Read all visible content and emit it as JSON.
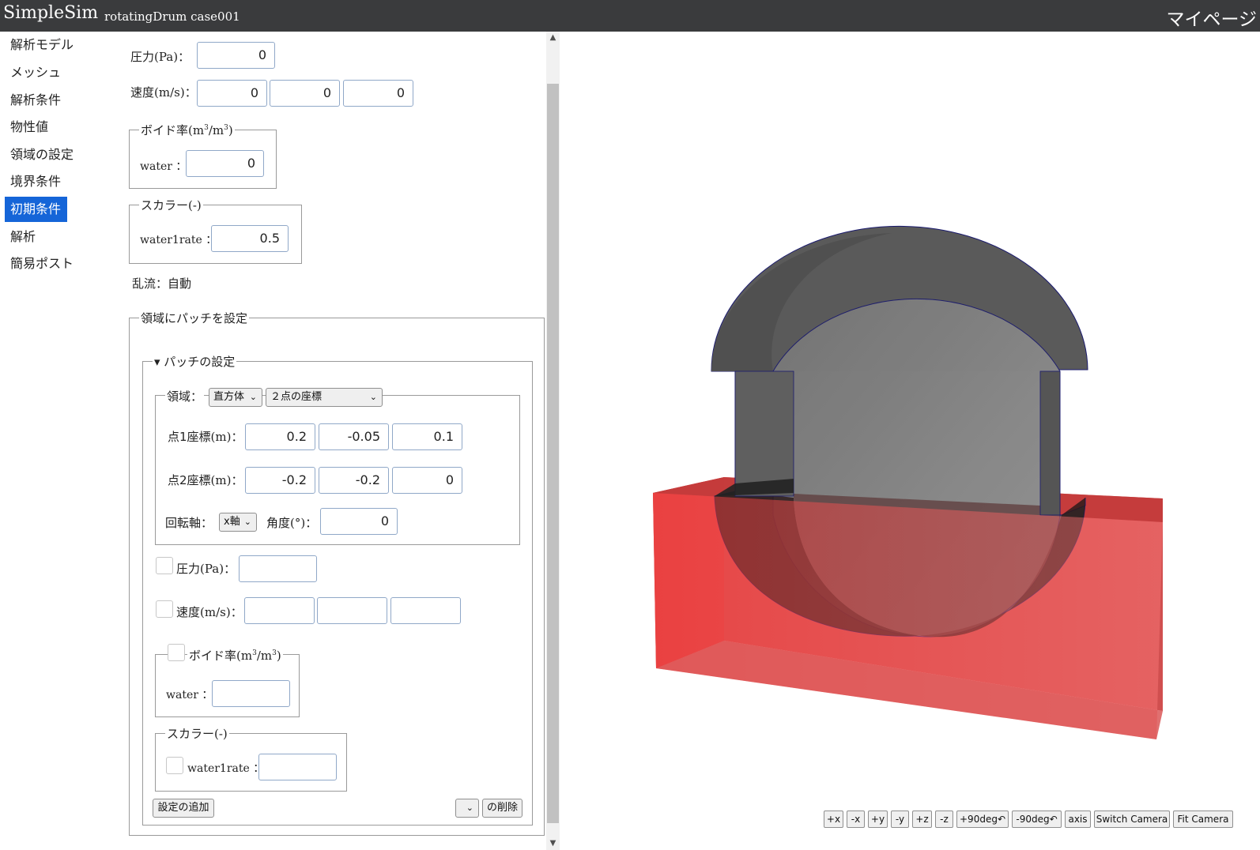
{
  "header": {
    "app_title": "SimpleSim",
    "case_name": "rotatingDrum case001",
    "mypage_label": "マイページ"
  },
  "sidebar": {
    "items": [
      {
        "label": "解析モデル"
      },
      {
        "label": "メッシュ"
      },
      {
        "label": "解析条件"
      },
      {
        "label": "物性値"
      },
      {
        "label": "領域の設定"
      },
      {
        "label": "境界条件"
      },
      {
        "label": "初期条件",
        "active": true
      },
      {
        "label": "解析"
      },
      {
        "label": "簡易ポスト"
      }
    ]
  },
  "initial": {
    "pressure": {
      "label_jp": "圧力",
      "unit": "(Pa)：",
      "value": "0"
    },
    "velocity": {
      "label_jp": "速度",
      "unit": "(m/s)：",
      "values": [
        "0",
        "0",
        "0"
      ]
    },
    "void": {
      "legend_jp": "ボイド率",
      "legend_unit": "(m3/m3)",
      "label": "water ：",
      "value": "0"
    },
    "scalar": {
      "legend_jp": "スカラー",
      "legend_unit": "(-)",
      "label": "water1rate ：",
      "value": "0.5"
    },
    "turbulence": "乱流：自動"
  },
  "patch_section": {
    "legend": "領域にパッチを設定",
    "patch": {
      "summary": "▾ パッチの設定",
      "region": {
        "label": "領域：",
        "shape": "直方体",
        "method": "２点の座標",
        "point1_label_jp": "点1座標",
        "point1_unit": "(m)：",
        "point1": [
          "0.2",
          "-0.05",
          "0.1"
        ],
        "point2_label_jp": "点2座標",
        "point2_unit": "(m)：",
        "point2": [
          "-0.2",
          "-0.2",
          "0"
        ],
        "axis_label": "回転軸：",
        "axis": "x軸",
        "angle_label_jp": "角度",
        "angle_unit": "(°)：",
        "angle": "0"
      },
      "pressure": {
        "label_jp": "圧力",
        "unit": "(Pa)：",
        "value": ""
      },
      "velocity": {
        "label_jp": "速度",
        "unit": "(m/s)：",
        "values": [
          "",
          "",
          ""
        ]
      },
      "void": {
        "legend_jp": "ボイド率",
        "legend_unit": "(m3/m3)",
        "label": "water ：",
        "value": ""
      },
      "scalar": {
        "legend_jp": "スカラー",
        "legend_unit": "(-)",
        "label": "water1rate ：",
        "value": ""
      }
    },
    "add_button": "設定の追加",
    "delete_select": "",
    "delete_button": "の削除"
  },
  "viewer": {
    "buttons": [
      "+x",
      "-x",
      "+y",
      "-y",
      "+z",
      "-z",
      "+90deg↶",
      "-90deg↶",
      "axis",
      "Switch Camera",
      "Fit Camera"
    ],
    "colors": {
      "drum": "#555555",
      "drum_edge": "#1a1a6e",
      "patch": "#ff4040"
    }
  }
}
